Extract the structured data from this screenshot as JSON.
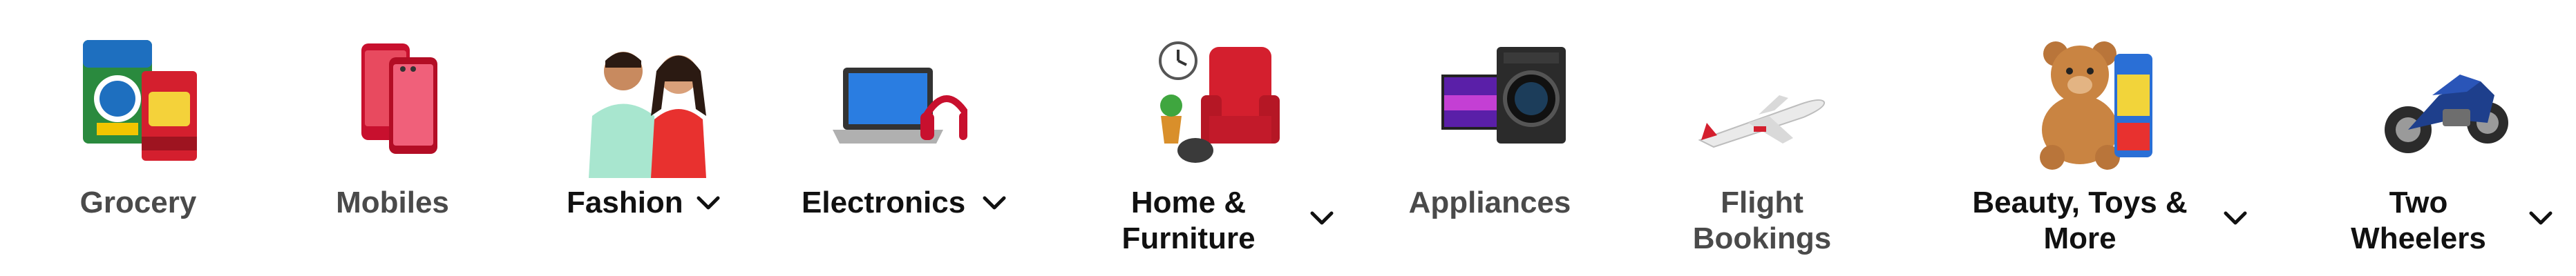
{
  "categories": [
    {
      "label": "Grocery",
      "icon": "grocery-icon",
      "has_dropdown": false
    },
    {
      "label": "Mobiles",
      "icon": "mobile-phone-icon",
      "has_dropdown": false
    },
    {
      "label": "Fashion",
      "icon": "fashion-icon",
      "has_dropdown": true
    },
    {
      "label": "Electronics",
      "icon": "laptop-headphones-icon",
      "has_dropdown": true
    },
    {
      "label_line1": "Home &",
      "label_line2": "Furniture",
      "icon": "armchair-icon",
      "has_dropdown": true
    },
    {
      "label": "Appliances",
      "icon": "tv-washing-machine-icon",
      "has_dropdown": false
    },
    {
      "label_line1": "Flight",
      "label_line2": "Bookings",
      "icon": "airplane-icon",
      "has_dropdown": false
    },
    {
      "label_line1": "Beauty, Toys &",
      "label_line2": "More",
      "icon": "teddy-bear-icon",
      "has_dropdown": true
    },
    {
      "label_line1": "Two",
      "label_line2": "Wheelers",
      "icon": "motorcycle-icon",
      "has_dropdown": true
    }
  ],
  "colors": {
    "text_dark": "#111111",
    "text_dim": "#4a4a4a",
    "background": "#ffffff"
  }
}
